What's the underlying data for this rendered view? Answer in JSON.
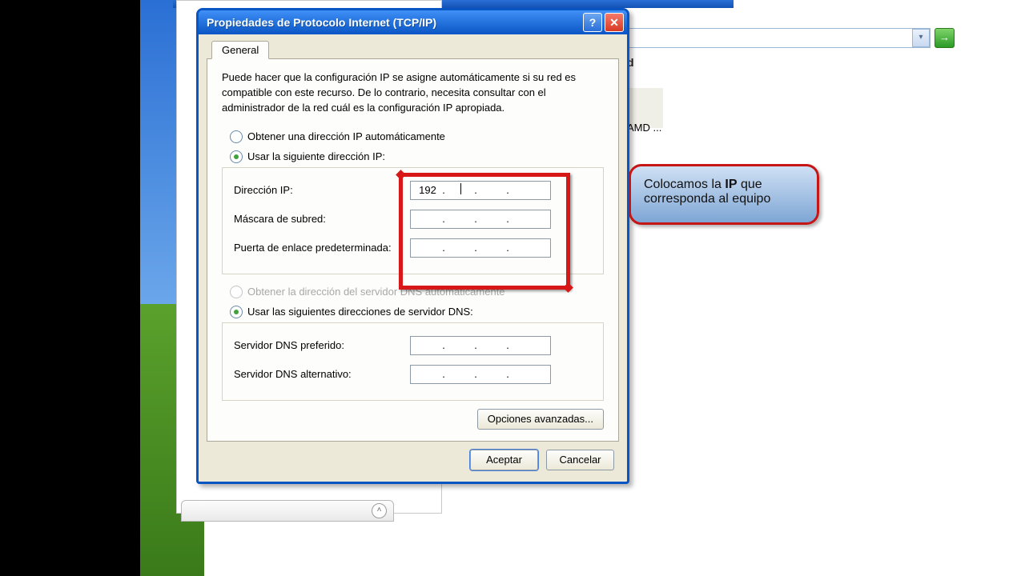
{
  "dialog": {
    "title": "Propiedades de Protocolo Internet (TCP/IP)",
    "tab_general": "General",
    "description": "Puede hacer que la configuración IP se asigne automáticamente si su red es compatible con este recurso. De lo contrario, necesita consultar con el administrador de la red cuál es la configuración IP apropiada.",
    "radio_auto_ip": "Obtener una dirección IP automáticamente",
    "radio_manual_ip": "Usar la siguiente dirección IP:",
    "label_ip": "Dirección IP:",
    "label_mask": "Máscara de subred:",
    "label_gateway": "Puerta de enlace predeterminada:",
    "radio_auto_dns": "Obtener la dirección del servidor DNS automáticamente",
    "radio_manual_dns": "Usar las siguientes direcciones de servidor DNS:",
    "label_dns1": "Servidor DNS preferido:",
    "label_dns2": "Servidor DNS alternativo:",
    "btn_adv": "Opciones avanzadas...",
    "btn_ok": "Aceptar",
    "btn_cancel": "Cancelar",
    "ip_value_oct1": "192",
    "help_char": "?",
    "close_char": "✕"
  },
  "background": {
    "letter_d": "d",
    "amd": "AMD ...",
    "dropdown_char": "▾",
    "go_char": "→",
    "chev_char": "˄"
  },
  "callout": {
    "part1": "Colocamos la ",
    "bold": "IP",
    "part2": " que corresponda al equipo"
  }
}
